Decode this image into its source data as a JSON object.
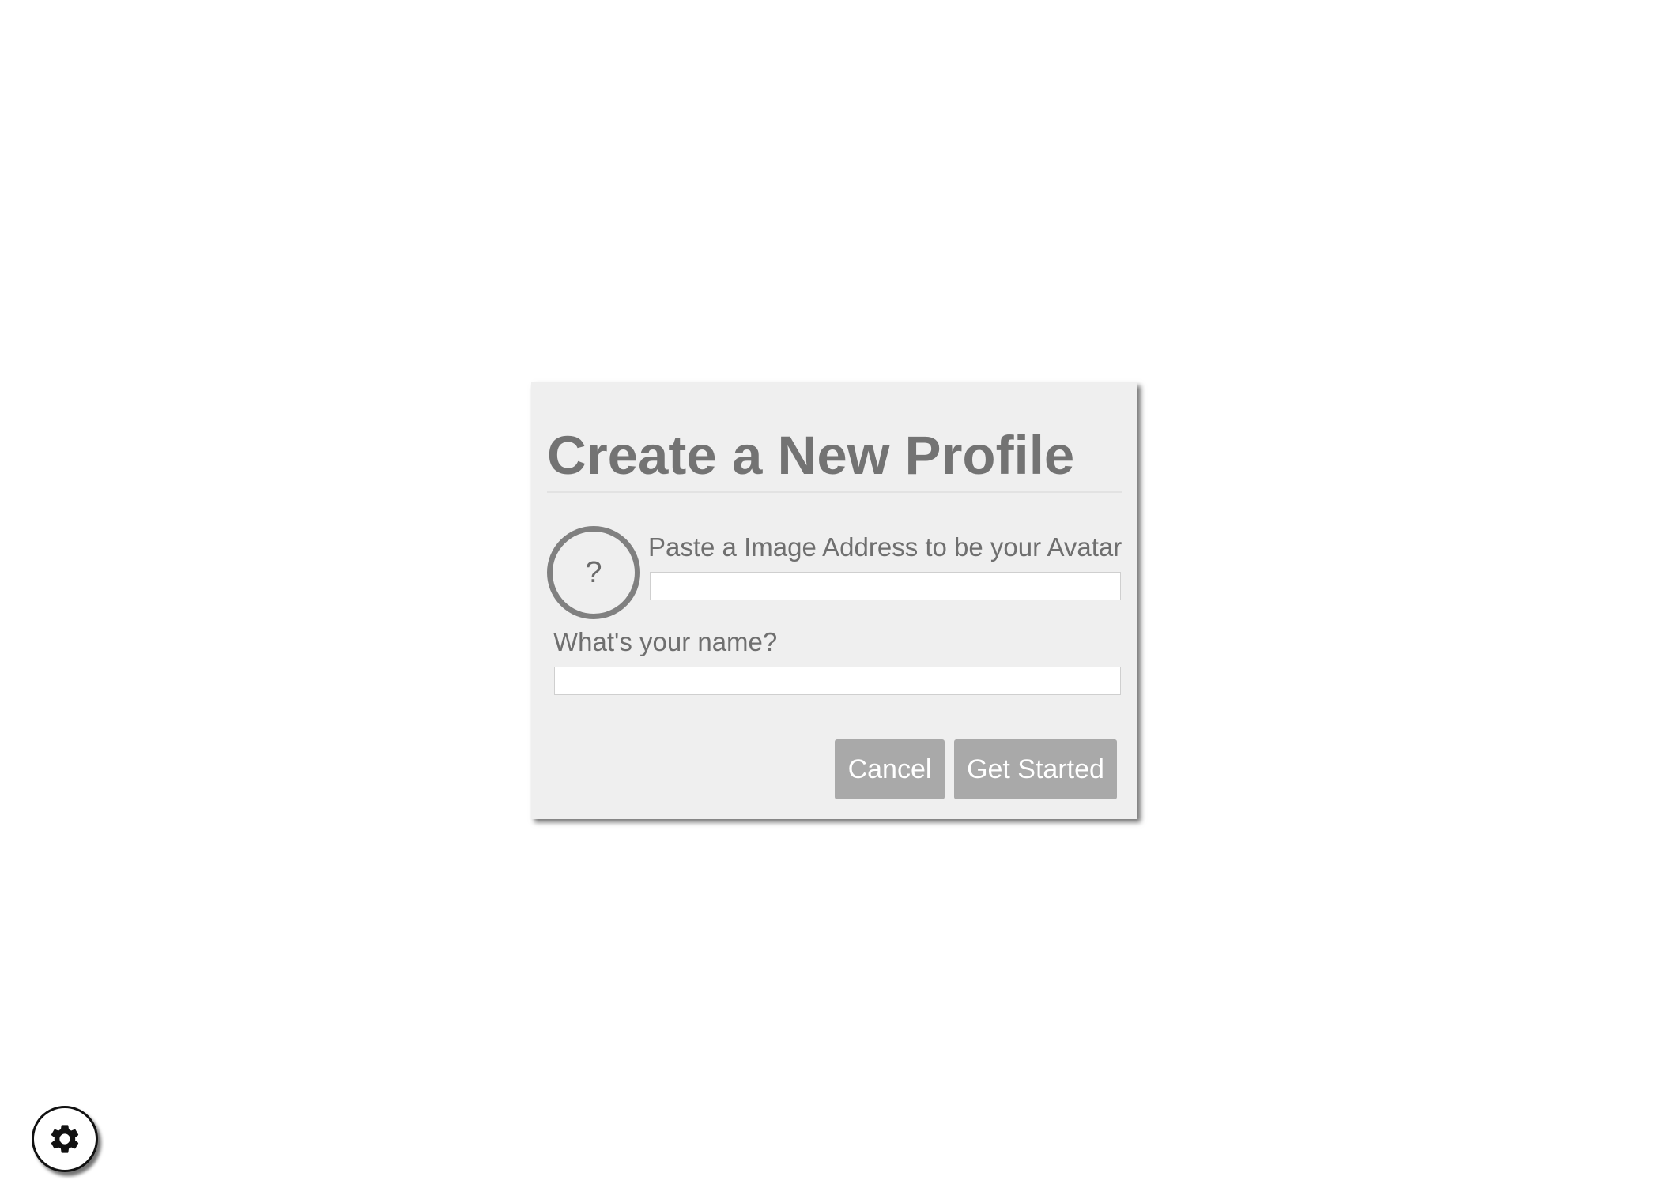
{
  "modal": {
    "title": "Create a New Profile",
    "avatar": {
      "placeholder_glyph": "?",
      "label": "Paste a Image Address to be your Avatar",
      "input_value": ""
    },
    "name": {
      "label": "What's your name?",
      "input_value": ""
    },
    "buttons": {
      "cancel_label": "Cancel",
      "start_label": "Get Started"
    }
  },
  "settings": {
    "icon": "gear-icon"
  },
  "colors": {
    "modal_bg": "#efefef",
    "title_text": "#737373",
    "button_bg": "#a9a9a9",
    "button_text": "#ffffff"
  }
}
